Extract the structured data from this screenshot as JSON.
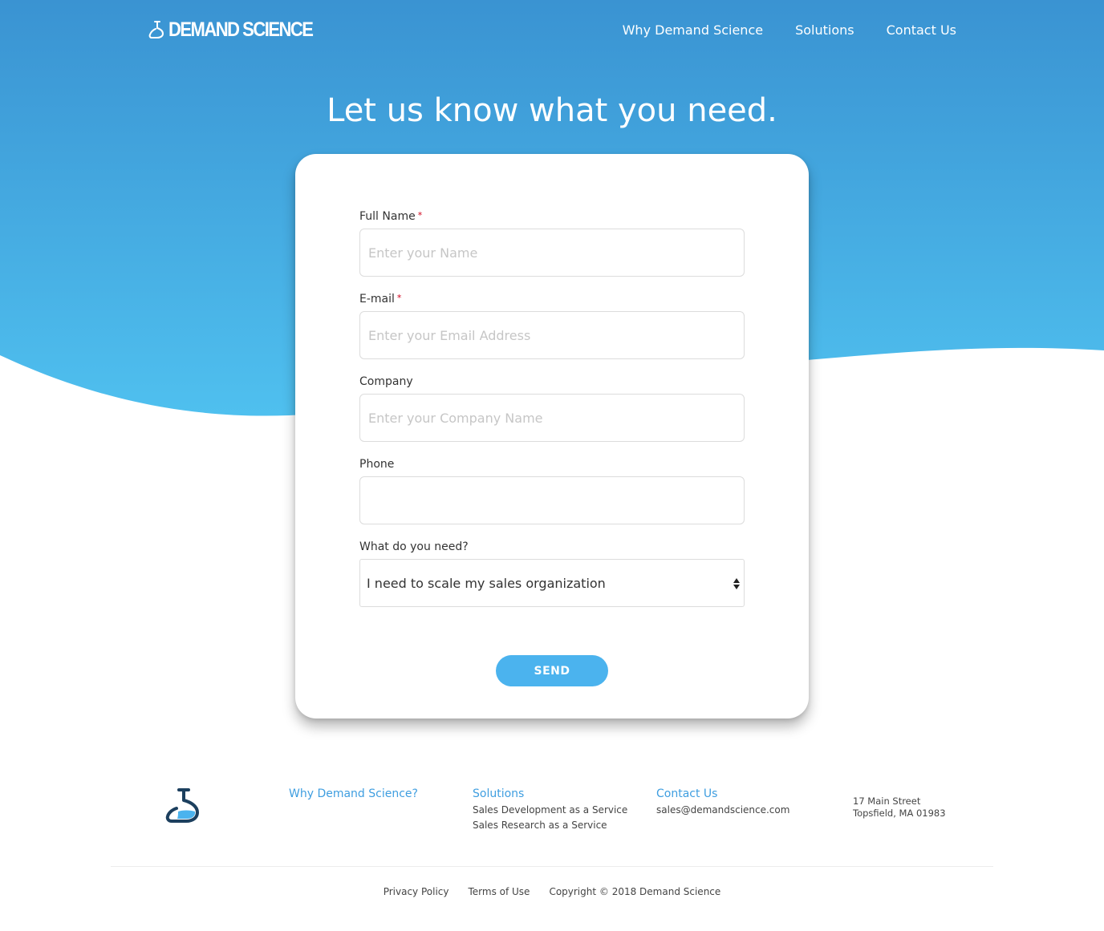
{
  "header": {
    "logo_text": "DEMAND SCIENCE",
    "nav": [
      "Why Demand Science",
      "Solutions",
      "Contact Us"
    ]
  },
  "hero": {
    "headline": "Let us know what you need."
  },
  "form": {
    "fields": [
      {
        "label": "Full Name",
        "required": true,
        "placeholder": "Enter your Name",
        "value": ""
      },
      {
        "label": "E-mail",
        "required": true,
        "placeholder": "Enter your Email Address",
        "value": ""
      },
      {
        "label": "Company",
        "required": false,
        "placeholder": "Enter your Company Name",
        "value": ""
      },
      {
        "label": "Phone",
        "required": false,
        "placeholder": "",
        "value": ""
      }
    ],
    "required_marker": "*",
    "select": {
      "label": "What do you need?",
      "value": "I need to scale my sales organization"
    },
    "submit_label": "SEND"
  },
  "footer": {
    "columns": [
      {
        "title": "Why Demand Science?",
        "links": []
      },
      {
        "title": "Solutions",
        "links": [
          "Sales Development as a Service",
          "Sales Research as a Service"
        ]
      },
      {
        "title": "Contact Us",
        "links": [
          "sales@demandscience.com"
        ]
      }
    ],
    "address": [
      "17 Main Street",
      "Topsfield, MA 01983"
    ],
    "bottom": {
      "privacy": "Privacy Policy",
      "terms": "Terms of Use",
      "copyright": "Copyright © 2018 Demand Science"
    }
  },
  "colors": {
    "hero_top": "#3a93d2",
    "hero_bottom": "#4fc0ef",
    "accent": "#4bb3ee",
    "link_blue": "#3f9ee0",
    "required_red": "#d0021b",
    "logo_dark": "#1c3f5e"
  }
}
